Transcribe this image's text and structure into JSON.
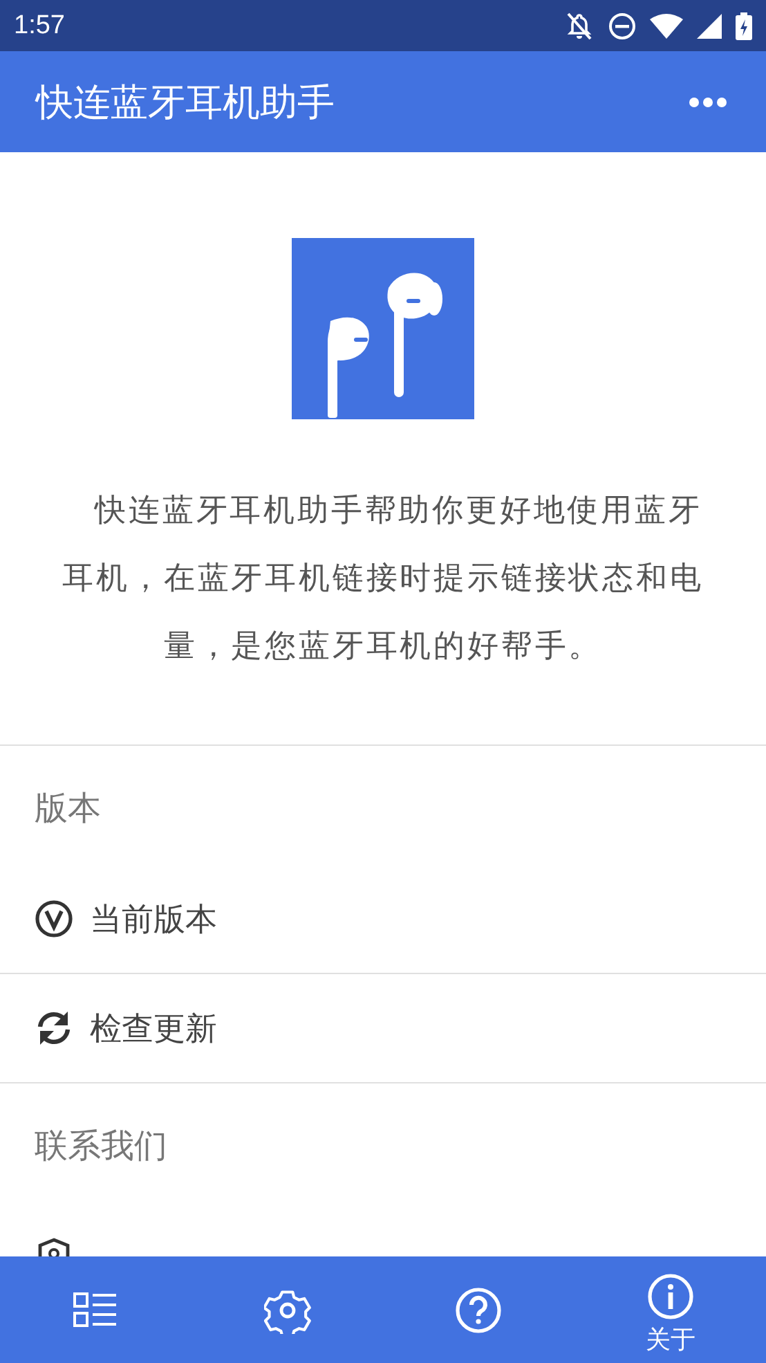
{
  "status_bar": {
    "time": "1:57"
  },
  "app_bar": {
    "title": "快连蓝牙耳机助手"
  },
  "intro": "快连蓝牙耳机助手帮助你更好地使用蓝牙耳机，在蓝牙耳机链接时提示链接状态和电量，是您蓝牙耳机的好帮手。",
  "sections": [
    {
      "title": "版本",
      "items": [
        {
          "kind": "version",
          "label": "当前版本"
        },
        {
          "kind": "update",
          "label": "检查更新"
        }
      ]
    },
    {
      "title": "联系我们",
      "items": [
        {
          "kind": "privacy"
        }
      ]
    }
  ],
  "bottom_nav": [
    {
      "selected": false
    },
    {
      "selected": false
    },
    {
      "selected": false
    },
    {
      "label": "关于",
      "selected": true
    }
  ]
}
